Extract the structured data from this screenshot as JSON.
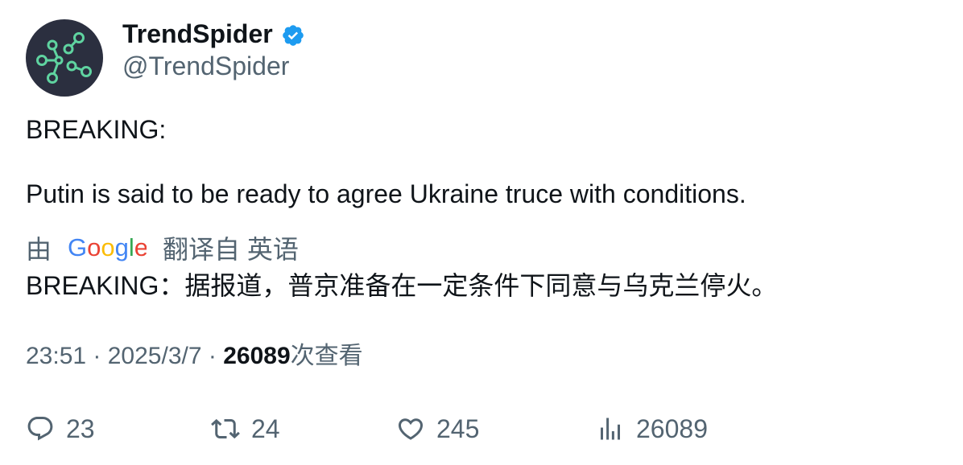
{
  "author": {
    "display_name": "TrendSpider",
    "handle": "@TrendSpider",
    "verified": true,
    "avatar_icon": "node-graph-logo"
  },
  "tweet": {
    "line1": "BREAKING:",
    "line2": "Putin is said to be ready to agree Ukraine truce with conditions.",
    "translation": {
      "by_label": "由",
      "provider": "Google",
      "from_label": "翻译自 英语",
      "text": "BREAKING：据报道，普京准备在一定条件下同意与乌克兰停火。"
    }
  },
  "meta": {
    "time": "23:51",
    "separator": " · ",
    "date": "2025/3/7",
    "views": "26089",
    "views_suffix": "次查看"
  },
  "actions": {
    "replies": "23",
    "retweets": "24",
    "likes": "245",
    "views": "26089"
  },
  "colors": {
    "text_primary": "#0f1419",
    "text_secondary": "#536471",
    "verified_blue": "#1d9bf0",
    "avatar_bg": "#2b2f3f",
    "avatar_accent": "#5fd3a0"
  }
}
